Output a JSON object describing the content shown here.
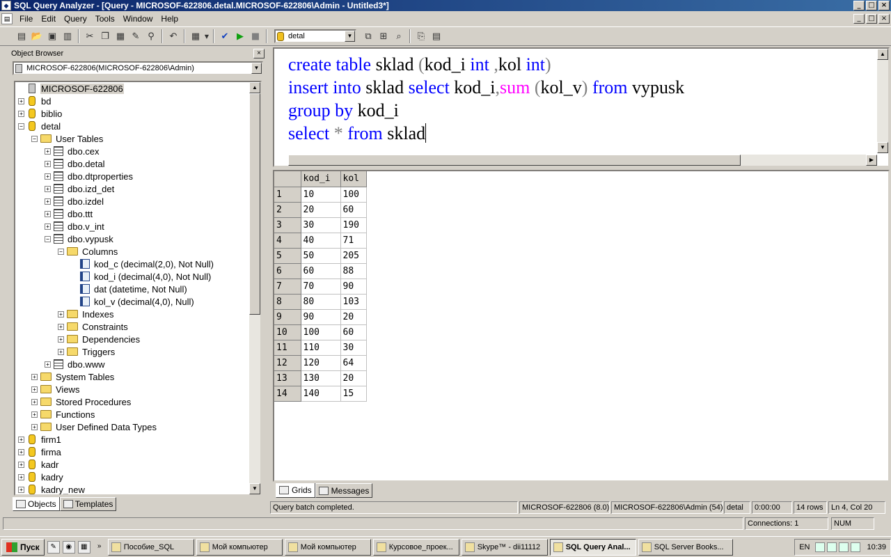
{
  "window": {
    "title": "SQL Query Analyzer - [Query - MICROSOF-622806.detal.MICROSOF-622806\\Admin - Untitled3*]",
    "min": "_",
    "max": "□",
    "close": "×"
  },
  "menu": [
    "File",
    "Edit",
    "Query",
    "Tools",
    "Window",
    "Help"
  ],
  "toolbar": {
    "database": "detal"
  },
  "object_browser": {
    "title": "Object Browser",
    "close": "×",
    "server_combo": "MICROSOF-622806(MICROSOF-622806\\Admin)",
    "tree": [
      {
        "label": "MICROSOF-622806",
        "depth": 0,
        "icon": "server",
        "pm": "",
        "selected": true
      },
      {
        "label": "bd",
        "depth": 0,
        "icon": "db",
        "pm": "+"
      },
      {
        "label": "biblio",
        "depth": 0,
        "icon": "db",
        "pm": "+"
      },
      {
        "label": "detal",
        "depth": 0,
        "icon": "db",
        "pm": "-"
      },
      {
        "label": "User Tables",
        "depth": 1,
        "icon": "folder",
        "pm": "-"
      },
      {
        "label": "dbo.cex",
        "depth": 2,
        "icon": "table",
        "pm": "+"
      },
      {
        "label": "dbo.detal",
        "depth": 2,
        "icon": "table",
        "pm": "+"
      },
      {
        "label": "dbo.dtproperties",
        "depth": 2,
        "icon": "table",
        "pm": "+"
      },
      {
        "label": "dbo.izd_det",
        "depth": 2,
        "icon": "table",
        "pm": "+"
      },
      {
        "label": "dbo.izdel",
        "depth": 2,
        "icon": "table",
        "pm": "+"
      },
      {
        "label": "dbo.ttt",
        "depth": 2,
        "icon": "table",
        "pm": "+"
      },
      {
        "label": "dbo.v_int",
        "depth": 2,
        "icon": "table",
        "pm": "+"
      },
      {
        "label": "dbo.vypusk",
        "depth": 2,
        "icon": "table",
        "pm": "-"
      },
      {
        "label": "Columns",
        "depth": 3,
        "icon": "folder",
        "pm": "-"
      },
      {
        "label": "kod_c (decimal(2,0), Not Null)",
        "depth": 4,
        "icon": "col",
        "pm": ""
      },
      {
        "label": "kod_i (decimal(4,0), Not Null)",
        "depth": 4,
        "icon": "col",
        "pm": ""
      },
      {
        "label": "dat (datetime, Not Null)",
        "depth": 4,
        "icon": "col",
        "pm": ""
      },
      {
        "label": "kol_v (decimal(4,0), Null)",
        "depth": 4,
        "icon": "col",
        "pm": ""
      },
      {
        "label": "Indexes",
        "depth": 3,
        "icon": "folder",
        "pm": "+"
      },
      {
        "label": "Constraints",
        "depth": 3,
        "icon": "folder",
        "pm": "+"
      },
      {
        "label": "Dependencies",
        "depth": 3,
        "icon": "folder",
        "pm": "+"
      },
      {
        "label": "Triggers",
        "depth": 3,
        "icon": "folder",
        "pm": "+"
      },
      {
        "label": "dbo.www",
        "depth": 2,
        "icon": "table",
        "pm": "+"
      },
      {
        "label": "System Tables",
        "depth": 1,
        "icon": "folder",
        "pm": "+"
      },
      {
        "label": "Views",
        "depth": 1,
        "icon": "folder",
        "pm": "+"
      },
      {
        "label": "Stored Procedures",
        "depth": 1,
        "icon": "folder",
        "pm": "+"
      },
      {
        "label": "Functions",
        "depth": 1,
        "icon": "folder",
        "pm": "+"
      },
      {
        "label": "User Defined Data Types",
        "depth": 1,
        "icon": "folder",
        "pm": "+"
      },
      {
        "label": "firm1",
        "depth": 0,
        "icon": "db",
        "pm": "+"
      },
      {
        "label": "firma",
        "depth": 0,
        "icon": "db",
        "pm": "+"
      },
      {
        "label": "kadr",
        "depth": 0,
        "icon": "db",
        "pm": "+"
      },
      {
        "label": "kadry",
        "depth": 0,
        "icon": "db",
        "pm": "+"
      },
      {
        "label": "kadry_new",
        "depth": 0,
        "icon": "db",
        "pm": "+"
      }
    ],
    "tabs": [
      "Objects",
      "Templates"
    ]
  },
  "editor": {
    "lines": [
      [
        [
          "kw",
          "create table "
        ],
        [
          "tx",
          "sklad "
        ],
        [
          "op",
          "("
        ],
        [
          "tx",
          "kod_i "
        ],
        [
          "kw",
          "int "
        ],
        [
          "op",
          ","
        ],
        [
          "tx",
          "kol "
        ],
        [
          "kw",
          "int"
        ],
        [
          "op",
          ")"
        ]
      ],
      [
        [
          "kw",
          "insert into "
        ],
        [
          "tx",
          "sklad "
        ],
        [
          "kw",
          "select "
        ],
        [
          "tx",
          "kod_i"
        ],
        [
          "op",
          ","
        ],
        [
          "fn",
          "sum "
        ],
        [
          "op",
          "("
        ],
        [
          "tx",
          "kol_v"
        ],
        [
          "op",
          ") "
        ],
        [
          "kw",
          "from "
        ],
        [
          "tx",
          "vypusk"
        ]
      ],
      [
        [
          "kw",
          "group by "
        ],
        [
          "tx",
          "kod_i"
        ]
      ],
      [
        [
          "kw",
          "select "
        ],
        [
          "op",
          "* "
        ],
        [
          "kw",
          "from "
        ],
        [
          "tx",
          "sklad"
        ]
      ]
    ]
  },
  "results": {
    "columns": [
      "kod_i",
      "kol"
    ],
    "rows": [
      [
        "1",
        "10",
        "100"
      ],
      [
        "2",
        "20",
        "60"
      ],
      [
        "3",
        "30",
        "190"
      ],
      [
        "4",
        "40",
        "71"
      ],
      [
        "5",
        "50",
        "205"
      ],
      [
        "6",
        "60",
        "88"
      ],
      [
        "7",
        "70",
        "90"
      ],
      [
        "8",
        "80",
        "103"
      ],
      [
        "9",
        "90",
        "20"
      ],
      [
        "10",
        "100",
        "60"
      ],
      [
        "11",
        "110",
        "30"
      ],
      [
        "12",
        "120",
        "64"
      ],
      [
        "13",
        "130",
        "20"
      ],
      [
        "14",
        "140",
        "15"
      ]
    ],
    "tabs": [
      "Grids",
      "Messages"
    ]
  },
  "query_status": {
    "message": "Query batch completed.",
    "server": "MICROSOF-622806 (8.0)",
    "user": "MICROSOF-622806\\Admin (54)",
    "db": "detal",
    "time": "0:00:00",
    "rows": "14 rows",
    "position": "Ln 4, Col 20"
  },
  "app_status": {
    "connections": "Connections: 1",
    "num": "NUM"
  },
  "taskbar": {
    "start": "Пуск",
    "more": "»",
    "tasks": [
      {
        "label": "Пособие_SQL",
        "active": false
      },
      {
        "label": "Мой компьютер",
        "active": false
      },
      {
        "label": "Мой компьютер",
        "active": false
      },
      {
        "label": "Курсовое_проек...",
        "active": false
      },
      {
        "label": "Skype™ - dii11112",
        "active": false
      },
      {
        "label": "SQL Query Anal...",
        "active": true
      },
      {
        "label": "SQL Server Books...",
        "active": false
      }
    ],
    "lang": "EN",
    "clock": "10:39"
  }
}
